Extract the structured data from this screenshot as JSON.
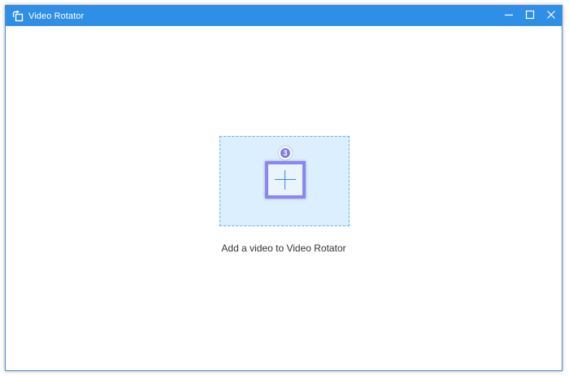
{
  "window": {
    "title": "Video Rotator",
    "app_icon": "rotate-icon",
    "controls": [
      "minimize-icon",
      "maximize-icon",
      "close-icon"
    ],
    "accent_color": "#2f8ee5"
  },
  "dropzone": {
    "step_badge": "3",
    "add_icon": "plus-icon",
    "highlight_color": "#8a87f0",
    "background_color": "#dcefff"
  },
  "hint": {
    "text": "Add a video to Video Rotator"
  }
}
